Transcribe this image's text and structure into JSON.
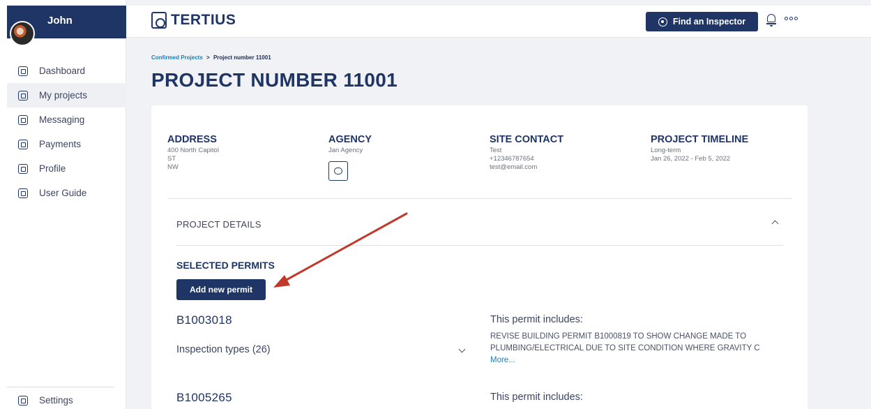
{
  "user": {
    "name": "John"
  },
  "sidebar": {
    "items": [
      {
        "label": "Dashboard",
        "icon": "dashboard-icon"
      },
      {
        "label": "My projects",
        "icon": "projects-icon",
        "active": true
      },
      {
        "label": "Messaging",
        "icon": "messaging-icon"
      },
      {
        "label": "Payments",
        "icon": "payments-icon"
      },
      {
        "label": "Profile",
        "icon": "profile-icon"
      },
      {
        "label": "User Guide",
        "icon": "pdf-icon"
      }
    ],
    "settings_label": "Settings"
  },
  "header": {
    "logo_text": "TERTIUS",
    "find_inspector_label": "Find an Inspector"
  },
  "breadcrumb": {
    "parent": "Confirmed Projects",
    "separator": ">",
    "current": "Project number 11001"
  },
  "page_title": "PROJECT NUMBER 11001",
  "summary": {
    "address": {
      "heading": "ADDRESS",
      "lines": [
        "400 North Capitol",
        "ST",
        "NW"
      ]
    },
    "agency": {
      "heading": "AGENCY",
      "name": "Jan Agency"
    },
    "site_contact": {
      "heading": "SITE CONTACT",
      "lines": [
        "Test",
        "+12346787654",
        "test@email.com"
      ]
    },
    "timeline": {
      "heading": "PROJECT TIMELINE",
      "lines": [
        "Long-term",
        "Jan 26, 2022 - Feb 5, 2022"
      ]
    }
  },
  "details": {
    "section_label": "PROJECT DETAILS",
    "permits_heading": "SELECTED PERMITS",
    "add_permit_label": "Add new permit",
    "permits": [
      {
        "id": "B1003018",
        "inspection_types": "Inspection types (26)",
        "includes_label": "This permit includes:",
        "description": [
          "REVISE BUILDING PERMIT B1000819 TO SHOW CHANGE MADE TO",
          "PLUMBING/ELECTRICAL DUE TO SITE CONDITION WHERE GRAVITY C"
        ],
        "more_label": "More..."
      },
      {
        "id": "B1005265",
        "includes_label": "This permit includes:"
      }
    ]
  },
  "colors": {
    "primary": "#1f3566",
    "link": "#1a7fb8",
    "annotation_arrow": "#c0392b"
  }
}
